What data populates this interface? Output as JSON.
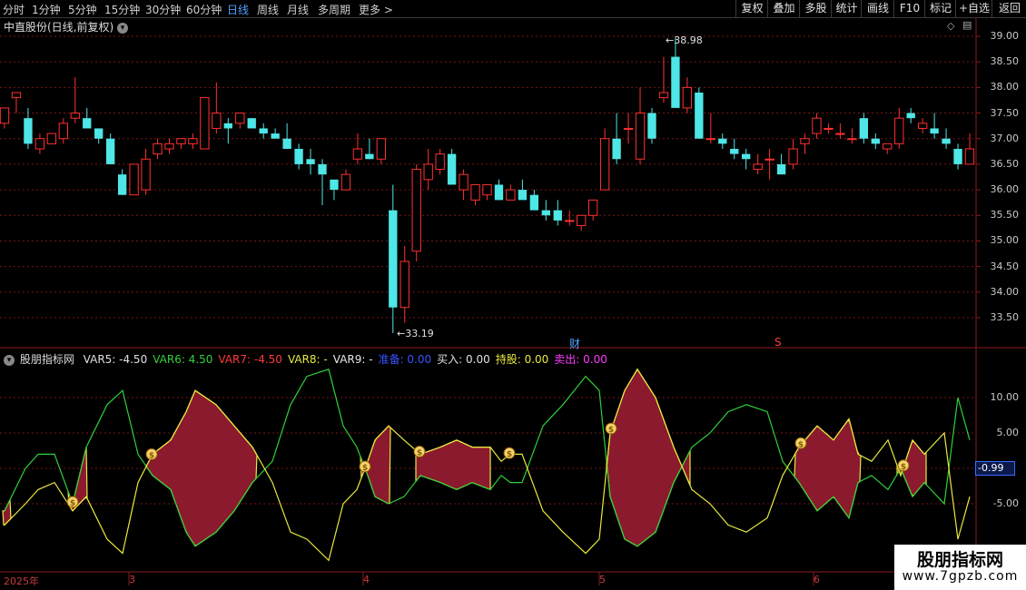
{
  "periods": [
    "分时",
    "1分钟",
    "5分钟",
    "15分钟",
    "30分钟",
    "60分钟",
    "日线",
    "周线",
    "月线",
    "多周期",
    "更多 >"
  ],
  "active_period": "日线",
  "toolbar": [
    "复权",
    "叠加",
    "多股",
    "统计",
    "画线",
    "F10",
    "标记",
    "+自选",
    "返回"
  ],
  "stock_title": "中直股份(日线,前复权)",
  "indicator": {
    "name": "股朋指标网",
    "items": [
      {
        "label": "VAR5: -4.50",
        "color": "#e0e0e0"
      },
      {
        "label": "VAR6: 4.50",
        "color": "#35d03a"
      },
      {
        "label": "VAR7: -4.50",
        "color": "#ff3a3a"
      },
      {
        "label": "VAR8: -",
        "color": "#e8e840"
      },
      {
        "label": "VAR9: -",
        "color": "#e8e8e8"
      },
      {
        "label": "准备: 0.00",
        "color": "#3a55ff"
      },
      {
        "label": "买入: 0.00",
        "color": "#e0e0e0"
      },
      {
        "label": "持股: 0.00",
        "color": "#e8e840"
      },
      {
        "label": "卖出: 0.00",
        "color": "#ff3aff"
      }
    ]
  },
  "price_axis": [
    "39.00",
    "38.50",
    "38.00",
    "37.50",
    "37.00",
    "36.50",
    "36.00",
    "35.50",
    "35.00",
    "34.50",
    "34.00",
    "33.50"
  ],
  "ind_axis": [
    "10.00",
    "5.00",
    "-5.00"
  ],
  "current_value": "-0.99",
  "high_label": "38.98",
  "low_label": "33.19",
  "markers": {
    "cai": "财",
    "s": "S"
  },
  "dates": [
    "2025年",
    "3",
    "4",
    "5",
    "6"
  ],
  "watermark": {
    "title": "股朋指标网",
    "url": "www.7gpzb.com"
  },
  "chart_data": {
    "type": "candlestick",
    "ylim": [
      33.0,
      39.25
    ],
    "candles": [
      [
        37.3,
        37.6,
        37.2,
        37.6
      ],
      [
        37.8,
        37.9,
        37.5,
        37.9
      ],
      [
        37.4,
        37.6,
        36.8,
        36.9
      ],
      [
        36.8,
        37.1,
        36.7,
        37.0
      ],
      [
        36.9,
        37.1,
        36.9,
        37.1
      ],
      [
        37.0,
        37.4,
        36.9,
        37.3
      ],
      [
        37.4,
        38.2,
        37.3,
        37.5
      ],
      [
        37.4,
        37.6,
        37.2,
        37.2
      ],
      [
        37.2,
        37.2,
        36.9,
        37.0
      ],
      [
        37.0,
        37.1,
        36.5,
        36.5
      ],
      [
        36.3,
        36.4,
        35.9,
        35.9
      ],
      [
        35.9,
        36.5,
        35.9,
        36.5
      ],
      [
        36.0,
        36.8,
        35.9,
        36.6
      ],
      [
        36.7,
        37.0,
        36.6,
        36.9
      ],
      [
        36.8,
        37.0,
        36.7,
        36.9
      ],
      [
        36.9,
        37.0,
        36.8,
        37.0
      ],
      [
        36.9,
        37.1,
        36.8,
        37.0
      ],
      [
        36.8,
        37.8,
        36.8,
        37.8
      ],
      [
        37.2,
        38.1,
        37.1,
        37.5
      ],
      [
        37.3,
        37.4,
        36.9,
        37.2
      ],
      [
        37.3,
        37.5,
        37.2,
        37.5
      ],
      [
        37.4,
        37.4,
        37.2,
        37.2
      ],
      [
        37.2,
        37.3,
        37.0,
        37.1
      ],
      [
        37.1,
        37.2,
        37.0,
        37.0
      ],
      [
        37.0,
        37.3,
        36.9,
        36.8
      ],
      [
        36.8,
        36.9,
        36.4,
        36.5
      ],
      [
        36.6,
        36.8,
        36.3,
        36.5
      ],
      [
        36.5,
        36.6,
        35.7,
        36.3
      ],
      [
        36.2,
        36.2,
        35.8,
        36.0
      ],
      [
        36.0,
        36.4,
        36.0,
        36.3
      ],
      [
        36.6,
        37.1,
        36.5,
        36.8
      ],
      [
        36.7,
        37.0,
        36.6,
        36.6
      ],
      [
        36.6,
        37.0,
        36.5,
        37.0
      ],
      [
        35.6,
        36.1,
        33.2,
        33.7
      ],
      [
        33.7,
        34.9,
        33.4,
        34.6
      ],
      [
        34.8,
        36.5,
        34.6,
        36.4
      ],
      [
        36.2,
        36.8,
        36.0,
        36.5
      ],
      [
        36.4,
        36.8,
        36.3,
        36.7
      ],
      [
        36.7,
        36.8,
        36.2,
        36.1
      ],
      [
        36.0,
        36.4,
        35.8,
        36.3
      ],
      [
        35.8,
        36.1,
        35.7,
        36.1
      ],
      [
        35.9,
        36.1,
        35.8,
        36.1
      ],
      [
        36.1,
        36.2,
        35.8,
        35.8
      ],
      [
        35.8,
        36.1,
        35.8,
        36.0
      ],
      [
        36.0,
        36.2,
        35.9,
        35.8
      ],
      [
        35.9,
        36.0,
        35.7,
        35.6
      ],
      [
        35.6,
        35.8,
        35.4,
        35.5
      ],
      [
        35.6,
        35.8,
        35.3,
        35.4
      ],
      [
        35.4,
        35.6,
        35.3,
        35.4
      ],
      [
        35.3,
        35.5,
        35.2,
        35.5
      ],
      [
        35.5,
        35.8,
        35.4,
        35.8
      ],
      [
        36.0,
        37.2,
        36.0,
        37.0
      ],
      [
        37.0,
        37.5,
        36.5,
        36.6
      ],
      [
        37.2,
        37.5,
        36.9,
        37.2
      ],
      [
        36.6,
        38.0,
        36.5,
        37.5
      ],
      [
        37.5,
        37.6,
        36.9,
        37.0
      ],
      [
        37.8,
        38.6,
        37.7,
        37.9
      ],
      [
        38.6,
        38.98,
        37.6,
        37.6
      ],
      [
        37.6,
        38.2,
        37.5,
        38.0
      ],
      [
        37.9,
        38.0,
        37.0,
        37.0
      ],
      [
        37.0,
        37.5,
        36.9,
        37.0
      ],
      [
        37.0,
        37.1,
        36.8,
        36.9
      ],
      [
        36.8,
        37.0,
        36.6,
        36.7
      ],
      [
        36.7,
        36.8,
        36.4,
        36.6
      ],
      [
        36.4,
        36.7,
        36.3,
        36.5
      ],
      [
        36.6,
        36.8,
        36.2,
        36.6
      ],
      [
        36.5,
        36.7,
        36.3,
        36.3
      ],
      [
        36.5,
        37.0,
        36.4,
        36.8
      ],
      [
        36.9,
        37.1,
        36.7,
        37.0
      ],
      [
        37.1,
        37.5,
        37.0,
        37.4
      ],
      [
        37.2,
        37.3,
        37.1,
        37.2
      ],
      [
        37.1,
        37.3,
        37.0,
        37.1
      ],
      [
        37.0,
        37.2,
        36.9,
        37.0
      ],
      [
        37.4,
        37.5,
        36.9,
        37.0
      ],
      [
        37.0,
        37.1,
        36.8,
        36.9
      ],
      [
        36.8,
        36.9,
        36.7,
        36.9
      ],
      [
        36.9,
        37.6,
        36.8,
        37.4
      ],
      [
        37.5,
        37.6,
        37.3,
        37.4
      ],
      [
        37.2,
        37.4,
        37.1,
        37.3
      ],
      [
        37.2,
        37.5,
        37.0,
        37.1
      ],
      [
        37.0,
        37.2,
        36.8,
        36.9
      ],
      [
        36.8,
        36.9,
        36.4,
        36.5
      ],
      [
        36.5,
        37.1,
        36.5,
        36.8
      ]
    ],
    "indicator_ylim": [
      -15.0,
      16.5
    ],
    "indicator_x": [
      5,
      28,
      42,
      60,
      80,
      95,
      118,
      135,
      152,
      168,
      188,
      205,
      215,
      238,
      258,
      278,
      300,
      320,
      338,
      362,
      378,
      393,
      405,
      413,
      428,
      445,
      463,
      485,
      503,
      520,
      540,
      552,
      562,
      575,
      598,
      620,
      645,
      660,
      672,
      688,
      702,
      722,
      742,
      762,
      782,
      802,
      822,
      845,
      862,
      880,
      900,
      918,
      935,
      945,
      960,
      978,
      992,
      1005,
      1018,
      1040,
      1055,
      1068
    ],
    "green": [
      -6,
      0,
      2,
      2,
      -5,
      3,
      9,
      11,
      2,
      -1,
      -3,
      -9,
      -11,
      -9,
      -6,
      -2,
      1,
      9,
      13,
      14,
      6,
      3,
      -1,
      -4,
      -5,
      -4,
      -1,
      -2,
      -3,
      -2,
      -3,
      -1,
      -2,
      -2,
      6,
      9,
      13,
      11,
      -4,
      -10,
      -11,
      -9,
      -2,
      3,
      5,
      8,
      9,
      8,
      1,
      -2,
      -6,
      -4,
      -7,
      -2,
      -1,
      -3,
      0,
      -4,
      -2,
      -5,
      10,
      4
    ],
    "yellow": [
      -8,
      -5,
      -3,
      -2,
      -6,
      -4,
      -10,
      -12,
      -2,
      2,
      4,
      8,
      11,
      9,
      6,
      3,
      -2,
      -9,
      -10,
      -13,
      -5,
      -3,
      1,
      4,
      6,
      4,
      2,
      3,
      4,
      3,
      3,
      1,
      2,
      2,
      -6,
      -9,
      -12,
      -10,
      5,
      11,
      14,
      10,
      3,
      -3,
      -5,
      -8,
      -9,
      -7,
      -1,
      3,
      6,
      4,
      7,
      2,
      1,
      4,
      -1,
      4,
      2,
      5,
      -10,
      -4
    ],
    "red_fill_spans": [
      [
        3,
        12
      ],
      [
        75,
        96
      ],
      [
        160,
        283
      ],
      [
        397,
        430
      ],
      [
        458,
        540
      ],
      [
        668,
        760
      ],
      [
        875,
        948
      ],
      [
        988,
        1020
      ]
    ],
    "buy_signals_x": [
      80,
      167,
      402,
      462,
      561,
      673,
      882,
      995
    ]
  }
}
